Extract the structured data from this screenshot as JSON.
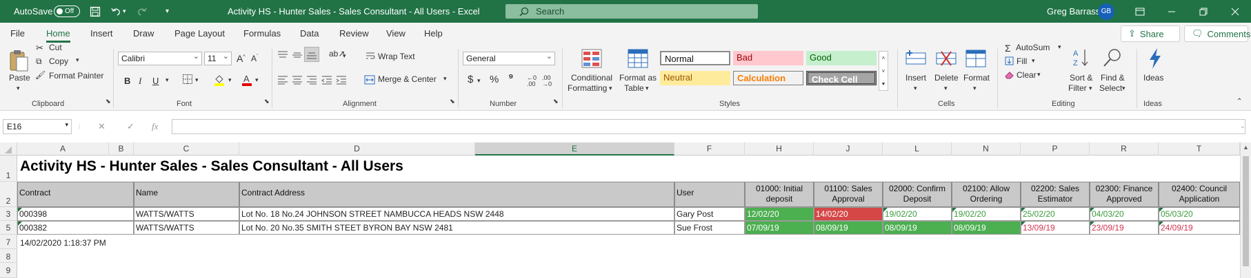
{
  "titlebar": {
    "autosave_label": "AutoSave",
    "autosave_state": "Off",
    "title": "Activity HS - Hunter Sales - Sales Consultant - All Users  -  Excel",
    "search_placeholder": "Search",
    "user_name": "Greg Barrass",
    "user_initials": "GB"
  },
  "menu": {
    "tabs": [
      "File",
      "Home",
      "Insert",
      "Draw",
      "Page Layout",
      "Formulas",
      "Data",
      "Review",
      "View",
      "Help"
    ],
    "active": "Home",
    "share": "Share",
    "comments": "Comments"
  },
  "ribbon": {
    "clipboard": {
      "paste": "Paste",
      "cut": "Cut",
      "copy": "Copy",
      "format_painter": "Format Painter",
      "group": "Clipboard"
    },
    "font": {
      "name": "Calibri",
      "size": "11",
      "group": "Font"
    },
    "alignment": {
      "wrap_text": "Wrap Text",
      "merge_center": "Merge & Center",
      "group": "Alignment"
    },
    "number": {
      "format": "General",
      "group": "Number"
    },
    "styles": {
      "conditional_1": "Conditional",
      "conditional_2": "Formatting",
      "format_table_1": "Format as",
      "format_table_2": "Table",
      "normal": "Normal",
      "bad": "Bad",
      "good": "Good",
      "neutral": "Neutral",
      "calculation": "Calculation",
      "check_cell": "Check Cell",
      "group": "Styles"
    },
    "cells": {
      "insert": "Insert",
      "delete": "Delete",
      "format": "Format",
      "group": "Cells"
    },
    "editing": {
      "autosum": "AutoSum",
      "fill": "Fill",
      "clear": "Clear",
      "sort_1": "Sort &",
      "sort_2": "Filter",
      "find_1": "Find &",
      "find_2": "Select",
      "group": "Editing"
    },
    "ideas": {
      "label": "Ideas",
      "group": "Ideas"
    }
  },
  "formula_bar": {
    "name_box": "E16",
    "formula": ""
  },
  "grid": {
    "columns": [
      "A",
      "B",
      "C",
      "D",
      "E",
      "F",
      "H",
      "J",
      "L",
      "N",
      "P",
      "R",
      "T"
    ],
    "rows": [
      "1",
      "2",
      "3",
      "5",
      "7",
      "8",
      "9"
    ],
    "sheet_title": "Activity HS - Hunter Sales - Sales Consultant - All Users",
    "headers": {
      "contract": "Contract",
      "name": "Name",
      "address": "Contract Address",
      "user": "User",
      "milestones": [
        [
          "01000: Initial",
          "deposit"
        ],
        [
          "01100: Sales",
          "Approval"
        ],
        [
          "02000: Confirm",
          "Deposit"
        ],
        [
          "02100: Allow",
          "Ordering"
        ],
        [
          "02200: Sales",
          "Estimator"
        ],
        [
          "02300: Finance",
          "Approved"
        ],
        [
          "02400: Council",
          "Application"
        ]
      ]
    },
    "records": [
      {
        "contract": "000398",
        "name": "WATTS/WATTS",
        "address": "Lot No. 18 No.24 JOHNSON STREET NAMBUCCA HEADS NSW 2448",
        "user": "Gary Post",
        "dates": [
          "12/02/20",
          "14/02/20",
          "19/02/20",
          "19/02/20",
          "25/02/20",
          "04/03/20",
          "05/03/20"
        ],
        "status": [
          "fill-green",
          "fill-red",
          "text-green",
          "text-green",
          "text-green",
          "text-green",
          "text-green"
        ]
      },
      {
        "contract": "000382",
        "name": "WATTS/WATTS",
        "address": "Lot No. 20 No.35 SMITH STEET BYRON BAY NSW 2481",
        "user": "Sue Frost",
        "dates": [
          "07/09/19",
          "08/09/19",
          "08/09/19",
          "08/09/19",
          "13/09/19",
          "23/09/19",
          "24/09/19"
        ],
        "status": [
          "fill-green",
          "fill-green",
          "fill-green",
          "fill-green",
          "text-red",
          "text-red",
          "text-red"
        ]
      }
    ],
    "timestamp": "14/02/2020 1:18:37 PM"
  },
  "colors": {
    "excel_green": "#217346",
    "fill_green": "#4caf50",
    "fill_red": "#d54747",
    "text_green": "#3a9a3a",
    "text_red": "#d0354f"
  }
}
